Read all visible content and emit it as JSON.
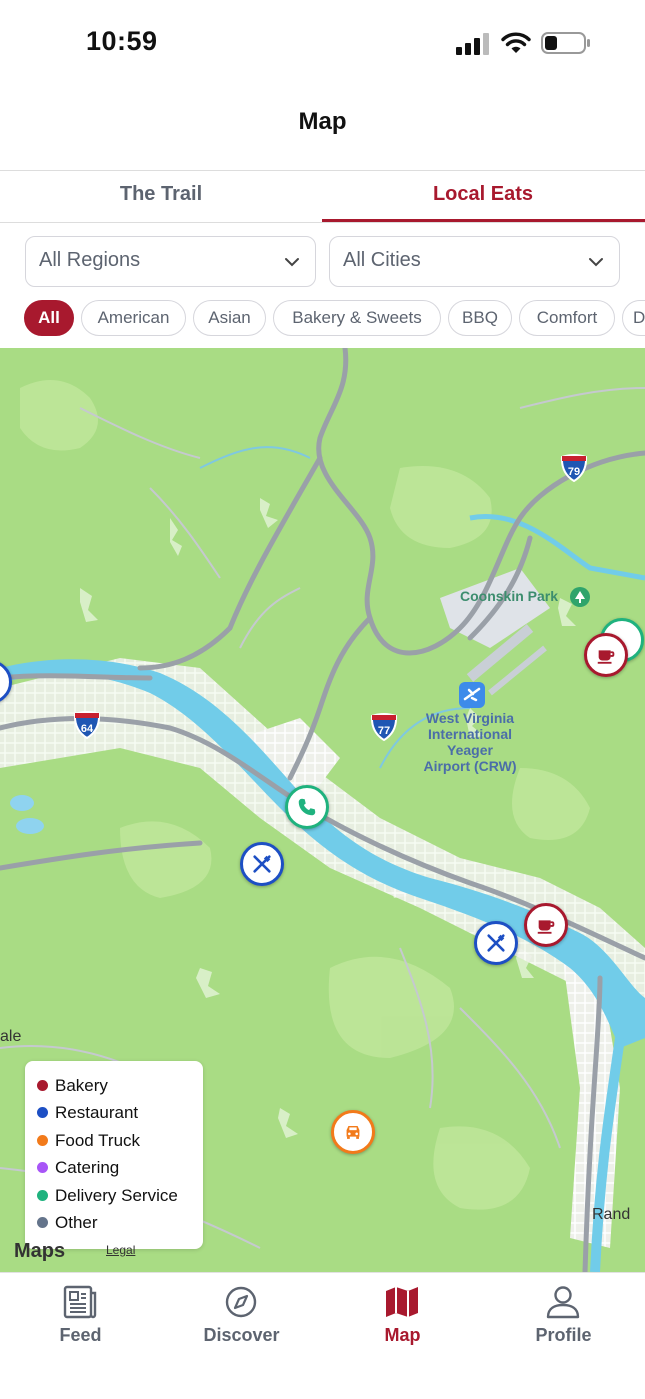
{
  "status_bar": {
    "time": "10:59"
  },
  "header": {
    "title": "Map"
  },
  "tabs": [
    {
      "label": "The Trail",
      "active": false
    },
    {
      "label": "Local Eats",
      "active": true
    }
  ],
  "filters": {
    "region": {
      "value": "All Regions"
    },
    "city": {
      "value": "All Cities"
    }
  },
  "categories": [
    "All",
    "American",
    "Asian",
    "Bakery & Sweets",
    "BBQ",
    "Comfort",
    "D"
  ],
  "map": {
    "labels": {
      "park": "Coonskin Park",
      "airport": [
        "West Virginia",
        "International",
        "Yeager",
        "Airport (CRW)"
      ],
      "town_left": "ale",
      "town_right": "Rand"
    },
    "highways": [
      "79",
      "64",
      "77"
    ],
    "pins": [
      {
        "type": "Delivery Service",
        "icon": "phone-icon"
      },
      {
        "type": "Restaurant",
        "icon": "fork-knife-icon"
      },
      {
        "type": "Restaurant",
        "icon": "fork-knife-icon"
      },
      {
        "type": "Bakery",
        "icon": "coffee-cup-icon"
      },
      {
        "type": "Bakery",
        "icon": "coffee-cup-icon"
      },
      {
        "type": "Food Truck",
        "icon": "car-icon"
      }
    ],
    "attribution": {
      "logo": "Maps",
      "legal": "Legal"
    }
  },
  "legend": [
    {
      "label": "Bakery",
      "color": "#a8192e"
    },
    {
      "label": "Restaurant",
      "color": "#1d4fc4"
    },
    {
      "label": "Food Truck",
      "color": "#f27a1a"
    },
    {
      "label": "Catering",
      "color": "#a855f7"
    },
    {
      "label": "Delivery Service",
      "color": "#1fb27e"
    },
    {
      "label": "Other",
      "color": "#64748b"
    }
  ],
  "colors": {
    "accent": "#a8192e",
    "muted": "#5d6470"
  },
  "bottom_nav": [
    {
      "label": "Feed",
      "icon": "newspaper-icon",
      "active": false
    },
    {
      "label": "Discover",
      "icon": "compass-icon",
      "active": false
    },
    {
      "label": "Map",
      "icon": "map-icon",
      "active": true
    },
    {
      "label": "Profile",
      "icon": "person-icon",
      "active": false
    }
  ]
}
